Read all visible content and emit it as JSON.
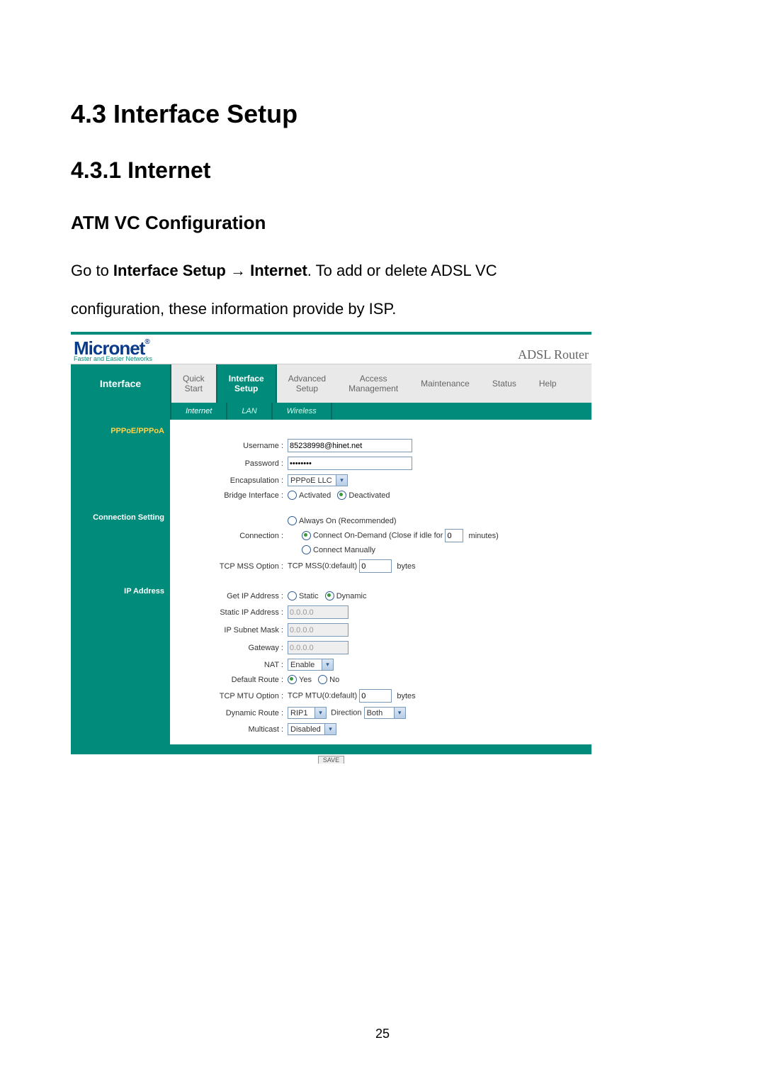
{
  "doc": {
    "h1": "4.3 Interface Setup",
    "h2": "4.3.1 Internet",
    "h3": "ATM VC Configuration",
    "para_prefix": "Go to ",
    "para_bold1": "Interface Setup",
    "para_arrow": " → ",
    "para_bold2": "Internet",
    "para_mid": ". To add or delete ADSL VC",
    "para_line2": "configuration, these information provide by ISP.",
    "page_number": "25"
  },
  "logo": {
    "brand": "Micronet",
    "reg": "®",
    "tagline": "Faster and Easier Networks",
    "device": "ADSL Router"
  },
  "nav": {
    "side": "Interface",
    "tabs": [
      {
        "line1": "Quick",
        "line2": "Start"
      },
      {
        "line1": "Interface",
        "line2": "Setup"
      },
      {
        "line1": "Advanced",
        "line2": "Setup"
      },
      {
        "line1": "Access",
        "line2": "Management"
      },
      {
        "line1": "Maintenance",
        "line2": ""
      },
      {
        "line1": "Status",
        "line2": ""
      },
      {
        "line1": "Help",
        "line2": ""
      }
    ],
    "subtabs": [
      "Internet",
      "LAN",
      "Wireless"
    ]
  },
  "sidebar": {
    "pppoe": "PPPoE/PPPoA",
    "conn": "Connection Setting",
    "ip": "IP Address"
  },
  "form": {
    "username_label": "Username :",
    "username_value": "85238998@hinet.net",
    "password_label": "Password :",
    "password_value": "••••••••",
    "encap_label": "Encapsulation :",
    "encap_value": "PPPoE LLC",
    "bridge_label": "Bridge Interface :",
    "bridge_opt_act": "Activated",
    "bridge_opt_deact": "Deactivated",
    "connection_label": "Connection :",
    "conn_always": "Always On (Recommended)",
    "conn_ondemand_pre": "Connect On-Demand (Close if idle for",
    "conn_ondemand_val": "0",
    "conn_ondemand_post": "minutes)",
    "conn_manual": "Connect Manually",
    "tcpmss_label": "TCP MSS Option :",
    "tcpmss_text": "TCP MSS(0:default)",
    "tcpmss_val": "0",
    "tcpmss_unit": "bytes",
    "getip_label": "Get IP Address :",
    "getip_static": "Static",
    "getip_dynamic": "Dynamic",
    "staticip_label": "Static IP Address :",
    "staticip_val": "0.0.0.0",
    "subnet_label": "IP Subnet Mask :",
    "subnet_val": "0.0.0.0",
    "gateway_label": "Gateway :",
    "gateway_val": "0.0.0.0",
    "nat_label": "NAT :",
    "nat_val": "Enable",
    "defroute_label": "Default Route :",
    "defroute_yes": "Yes",
    "defroute_no": "No",
    "tcpmtu_label": "TCP MTU Option :",
    "tcpmtu_text": "TCP MTU(0:default)",
    "tcpmtu_val": "0",
    "tcpmtu_unit": "bytes",
    "dynroute_label": "Dynamic Route :",
    "dynroute_val": "RIP1",
    "direction_label": "Direction",
    "direction_val": "Both",
    "multicast_label": "Multicast :",
    "multicast_val": "Disabled",
    "save_stub": "SAVE"
  }
}
